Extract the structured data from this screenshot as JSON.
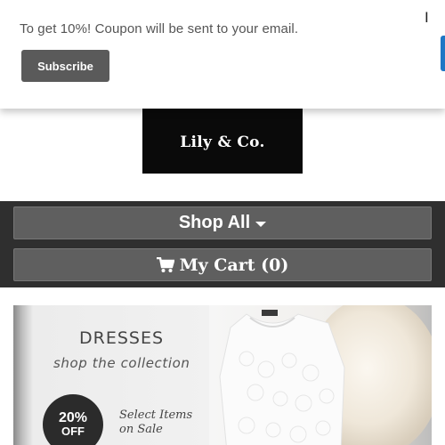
{
  "popup": {
    "message": "To get 10%! Coupon will be sent to your email.",
    "subscribe_label": "Subscribe",
    "close_label": "I"
  },
  "logo": {
    "text": "Lily & Co."
  },
  "nav": {
    "shop_all_label": "Shop All",
    "cart_label": "My Cart (0)",
    "shop_all_icon": "caret-down-icon",
    "cart_icon": "shopping-cart-icon"
  },
  "banner": {
    "title": "DRESSES",
    "tagline": "shop the collection",
    "discount_percent": "20%",
    "discount_off": "OFF",
    "sale_line1": "Select Items",
    "sale_line2": "on Sale"
  },
  "colors": {
    "nav_background": "#2f2f2f",
    "nav_button": "#5f5f5f",
    "subscribe_button": "#5a5a5a",
    "logo_background": "#0a0a0a",
    "accent_blue": "#1f77c5"
  }
}
